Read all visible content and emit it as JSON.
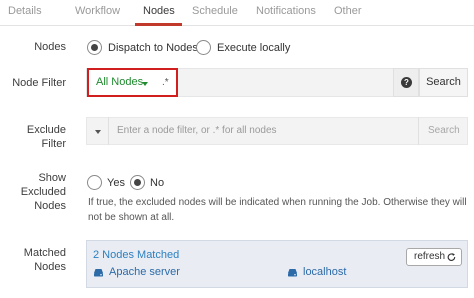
{
  "tabs": [
    {
      "label": "Details",
      "active": false
    },
    {
      "label": "Workflow",
      "active": false
    },
    {
      "label": "Nodes",
      "active": true
    },
    {
      "label": "Schedule",
      "active": false
    },
    {
      "label": "Notifications",
      "active": false
    },
    {
      "label": "Other",
      "active": false
    }
  ],
  "nodes_section": {
    "label": "Nodes",
    "dispatch_label": "Dispatch to Nodes",
    "dispatch_selected": true,
    "local_label": "Execute locally",
    "local_selected": false
  },
  "node_filter": {
    "label": "Node Filter",
    "dropdown_value": "All Nodes",
    "regex_label": ".*",
    "search_label": "Search",
    "help_icon": "question-circle-icon"
  },
  "exclude_filter": {
    "label_line1": "Exclude",
    "label_line2": "Filter",
    "placeholder": "Enter a node filter, or .* for all nodes",
    "search_label": "Search"
  },
  "show_excluded": {
    "label_line1": "Show",
    "label_line2": "Excluded",
    "label_line3": "Nodes",
    "yes_label": "Yes",
    "yes_selected": false,
    "no_label": "No",
    "no_selected": true,
    "help_line1": "If true, the excluded nodes will be indicated when running the Job. Otherwise they will",
    "help_line2": "not be shown at all."
  },
  "matched_nodes": {
    "label_line1": "Matched",
    "label_line2": "Nodes",
    "title": "2 Nodes Matched",
    "refresh_label": "refresh",
    "nodes": [
      {
        "name": "Apache server",
        "icon": "server-icon"
      },
      {
        "name": "localhost",
        "icon": "server-icon"
      }
    ]
  },
  "colors": {
    "active_tab_underline": "#c0392b",
    "highlight_border": "#d11f1f",
    "all_nodes_green": "#1f8a2e",
    "matched_title_blue": "#2c7fc0",
    "node_link_blue": "#2c6aa8"
  }
}
